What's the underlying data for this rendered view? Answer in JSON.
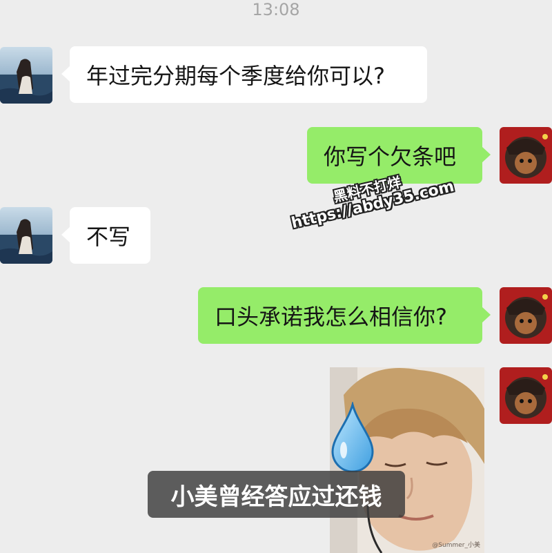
{
  "status": {
    "time": "13:08"
  },
  "messages": [
    {
      "side": "in",
      "text": "年过完分期每个季度给你可以?"
    },
    {
      "side": "out",
      "text": "你写个欠条吧"
    },
    {
      "side": "in",
      "text": "不写"
    },
    {
      "side": "out",
      "text": "口头承诺我怎么相信你?"
    }
  ],
  "watermark": {
    "line1": "黑料不打烊",
    "line2": "https://abdy35.com"
  },
  "sticker": {
    "caption": "小美曾经答应过还钱",
    "credit": "@Summer_小美"
  },
  "colors": {
    "background": "#ededed",
    "incoming": "#ffffff",
    "outgoing": "#95ec69"
  }
}
